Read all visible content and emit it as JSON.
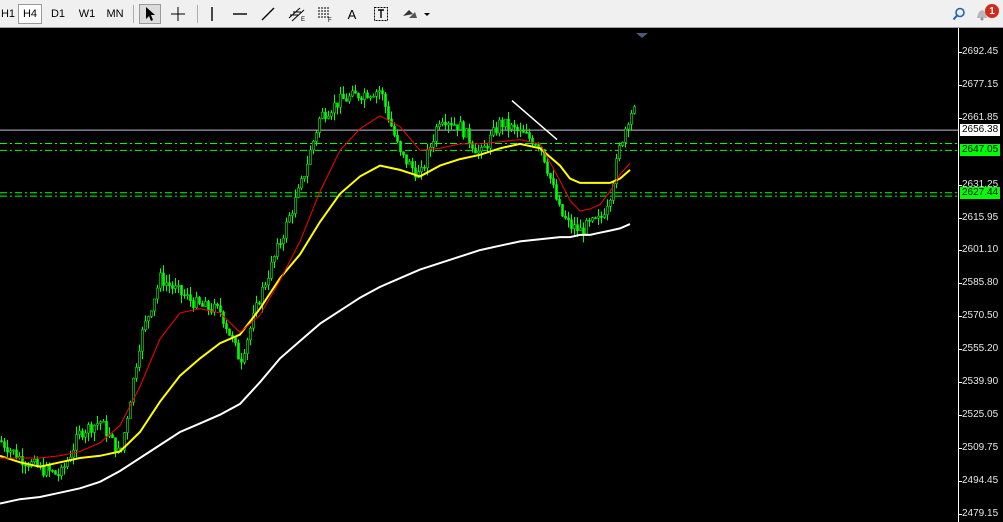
{
  "toolbar": {
    "timeframes": [
      {
        "label": "H1",
        "active": false
      },
      {
        "label": "H4",
        "active": true
      },
      {
        "label": "D1",
        "active": false
      },
      {
        "label": "W1",
        "active": false
      },
      {
        "label": "MN",
        "active": false
      }
    ],
    "tools": [
      "cursor-icon",
      "crosshair-icon",
      "vertical-line-icon",
      "horizontal-line-icon",
      "trendline-icon",
      "equidistant-channel-icon",
      "fibonacci-icon",
      "text-icon",
      "text-label-icon",
      "shapes-dropdown-icon"
    ],
    "text_tool_label": "A",
    "notification_count": "1"
  },
  "price_axis": {
    "ticks": [
      "2692.45",
      "2677.15",
      "2661.85",
      "2631.25",
      "2615.95",
      "2601.10",
      "2585.80",
      "2570.50",
      "2555.20",
      "2539.90",
      "2525.05",
      "2509.75",
      "2494.45",
      "2479.15"
    ],
    "current_price": "2656.38",
    "level_labels": [
      "2647.05",
      "2627.44"
    ]
  },
  "colors": {
    "candle": "#00ff00",
    "ma_yellow": "#ffff00",
    "ma_red": "#ff0000",
    "ma_white": "#ffffff",
    "level_line": "#00ff00",
    "current_price_line": "#c0c0d0"
  },
  "chart_data": {
    "type": "line",
    "x": [
      0,
      20,
      40,
      60,
      80,
      100,
      120,
      140,
      160,
      180,
      200,
      220,
      240,
      260,
      280,
      300,
      320,
      340,
      360,
      380,
      400,
      420,
      440,
      460,
      480,
      500,
      520,
      540,
      560,
      570,
      580,
      590,
      600,
      610,
      620,
      630
    ],
    "series": [
      {
        "values": [
          2513,
          2505,
          2500,
          2497,
          2517,
          2522,
          2506,
          2560,
          2588,
          2581,
          2575,
          2573,
          2550,
          2580,
          2605,
          2630,
          2663,
          2670,
          2673,
          2675,
          2645,
          2635,
          2663,
          2658,
          2645,
          2660,
          2655,
          2650,
          2618,
          2612,
          2610,
          2613,
          2615,
          2627,
          2650,
          2665
        ]
      },
      {
        "values": [
          2505,
          2505,
          2505,
          2506,
          2508,
          2512,
          2520,
          2538,
          2560,
          2572,
          2574,
          2572,
          2563,
          2571,
          2587,
          2605,
          2628,
          2647,
          2657,
          2663,
          2658,
          2647,
          2648,
          2650,
          2650,
          2651,
          2652,
          2650,
          2633,
          2624,
          2619,
          2620,
          2622,
          2628,
          2636,
          2641
        ]
      },
      {
        "values": [
          2506,
          2503,
          2501,
          2503,
          2505,
          2506,
          2508,
          2517,
          2531,
          2543,
          2551,
          2558,
          2562,
          2574,
          2588,
          2599,
          2614,
          2627,
          2635,
          2640,
          2638,
          2635,
          2640,
          2643,
          2645,
          2648,
          2650,
          2648,
          2640,
          2634,
          2632,
          2632,
          2632,
          2632,
          2634,
          2638
        ]
      },
      {
        "values": [
          2484,
          2486,
          2487,
          2489,
          2491,
          2494,
          2499,
          2505,
          2511,
          2517,
          2521,
          2525,
          2530,
          2540,
          2551,
          2559,
          2567,
          2573,
          2579,
          2584,
          2588,
          2592,
          2595,
          2598,
          2601,
          2603,
          2605,
          2606,
          2607,
          2607,
          2608,
          2608,
          2609,
          2610,
          2611,
          2613
        ]
      }
    ],
    "ylim": [
      2479.15,
      2700.0
    ],
    "levels": [
      2647.05,
      2627.44,
      2650.2,
      2625.9
    ],
    "current_price": 2656.38,
    "trendline": {
      "from": [
        512,
        2670
      ],
      "to": [
        557,
        2652
      ]
    }
  }
}
